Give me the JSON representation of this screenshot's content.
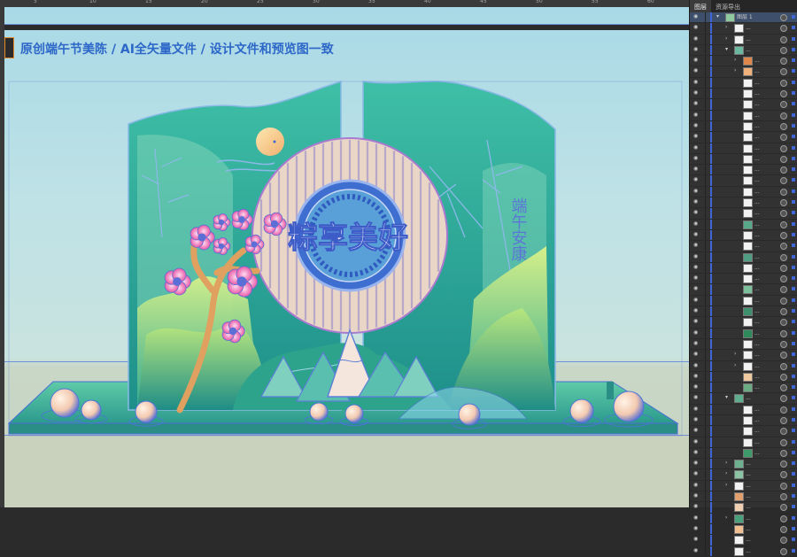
{
  "ruler": {
    "ticks": [
      "5",
      "10",
      "15",
      "20",
      "25",
      "30",
      "35",
      "40",
      "45",
      "50",
      "55",
      "60"
    ]
  },
  "headline": "原创端午节美陈 / AI全矢量文件 / 设计文件和预览图一致",
  "design": {
    "title": "粽享美好",
    "vertical_text": "端午安康"
  },
  "layers_panel": {
    "tabs": [
      "图层",
      "资源导出"
    ],
    "top_layer_name": "图层 1",
    "rows": [
      {
        "type": "layer",
        "indent": 0,
        "expand": "▾",
        "thumb": "#8fc9a0",
        "name": "图层 1",
        "sel": true
      },
      {
        "type": "item",
        "indent": 1,
        "expand": "›",
        "thumb": "#f2f2f2",
        "name": "...",
        "sel": false
      },
      {
        "type": "item",
        "indent": 1,
        "expand": "›",
        "thumb": "#f2f2f2",
        "name": "...",
        "sel": false
      },
      {
        "type": "item",
        "indent": 1,
        "expand": "▾",
        "thumb": "#6cb7a0",
        "name": "...",
        "sel": false
      },
      {
        "type": "item",
        "indent": 2,
        "expand": "›",
        "thumb": "#e0874c",
        "name": "...",
        "sel": false
      },
      {
        "type": "item",
        "indent": 2,
        "expand": "›",
        "thumb": "#f0b27a",
        "name": "...",
        "sel": false
      },
      {
        "type": "item",
        "indent": 2,
        "expand": "",
        "thumb": "#f2f2f2",
        "name": "...",
        "sel": false
      },
      {
        "type": "item",
        "indent": 2,
        "expand": "",
        "thumb": "#f2f2f2",
        "name": "...",
        "sel": false
      },
      {
        "type": "item",
        "indent": 2,
        "expand": "",
        "thumb": "#f2f2f2",
        "name": "...",
        "sel": false
      },
      {
        "type": "item",
        "indent": 2,
        "expand": "",
        "thumb": "#f2f2f2",
        "name": "...",
        "sel": false
      },
      {
        "type": "item",
        "indent": 2,
        "expand": "",
        "thumb": "#f2f2f2",
        "name": "...",
        "sel": false
      },
      {
        "type": "item",
        "indent": 2,
        "expand": "",
        "thumb": "#f2f2f2",
        "name": "...",
        "sel": false
      },
      {
        "type": "item",
        "indent": 2,
        "expand": "",
        "thumb": "#f2f2f2",
        "name": "...",
        "sel": false
      },
      {
        "type": "item",
        "indent": 2,
        "expand": "",
        "thumb": "#f2f2f2",
        "name": "...",
        "sel": false
      },
      {
        "type": "item",
        "indent": 2,
        "expand": "",
        "thumb": "#f2f2f2",
        "name": "...",
        "sel": false
      },
      {
        "type": "item",
        "indent": 2,
        "expand": "",
        "thumb": "#f2f2f2",
        "name": "...",
        "sel": false
      },
      {
        "type": "item",
        "indent": 2,
        "expand": "",
        "thumb": "#f2f2f2",
        "name": "...",
        "sel": false
      },
      {
        "type": "item",
        "indent": 2,
        "expand": "",
        "thumb": "#f2f2f2",
        "name": "...",
        "sel": false
      },
      {
        "type": "item",
        "indent": 2,
        "expand": "",
        "thumb": "#f2f2f2",
        "name": "...",
        "sel": false
      },
      {
        "type": "item",
        "indent": 2,
        "expand": "",
        "thumb": "#5aa88a",
        "name": "...",
        "sel": false
      },
      {
        "type": "item",
        "indent": 2,
        "expand": "",
        "thumb": "#f2f2f2",
        "name": "...",
        "sel": false
      },
      {
        "type": "item",
        "indent": 2,
        "expand": "",
        "thumb": "#f2f2f2",
        "name": "...",
        "sel": false
      },
      {
        "type": "item",
        "indent": 2,
        "expand": "",
        "thumb": "#4f9e84",
        "name": "...",
        "sel": false
      },
      {
        "type": "item",
        "indent": 2,
        "expand": "",
        "thumb": "#f2f2f2",
        "name": "...",
        "sel": false
      },
      {
        "type": "item",
        "indent": 2,
        "expand": "",
        "thumb": "#f2f2f2",
        "name": "...",
        "sel": false
      },
      {
        "type": "item",
        "indent": 2,
        "expand": "",
        "thumb": "#7bbf9a",
        "name": "...",
        "sel": false
      },
      {
        "type": "item",
        "indent": 2,
        "expand": "",
        "thumb": "#f2f2f2",
        "name": "...",
        "sel": false
      },
      {
        "type": "item",
        "indent": 2,
        "expand": "",
        "thumb": "#3e8f6c",
        "name": "...",
        "sel": false
      },
      {
        "type": "item",
        "indent": 2,
        "expand": "",
        "thumb": "#f2f2f2",
        "name": "...",
        "sel": false
      },
      {
        "type": "item",
        "indent": 2,
        "expand": "",
        "thumb": "#2e8a5a",
        "name": "...",
        "sel": false
      },
      {
        "type": "item",
        "indent": 2,
        "expand": "",
        "thumb": "#f2f2f2",
        "name": "...",
        "sel": false
      },
      {
        "type": "item",
        "indent": 2,
        "expand": "›",
        "thumb": "#f2f2f2",
        "name": "...",
        "sel": false
      },
      {
        "type": "item",
        "indent": 2,
        "expand": "›",
        "thumb": "#f2f2f2",
        "name": "...",
        "sel": false
      },
      {
        "type": "item",
        "indent": 2,
        "expand": "",
        "thumb": "#f0c9a0",
        "name": "...",
        "sel": false
      },
      {
        "type": "item",
        "indent": 2,
        "expand": "",
        "thumb": "#6aab84",
        "name": "...",
        "sel": false
      },
      {
        "type": "item",
        "indent": 1,
        "expand": "▾",
        "thumb": "#5fae8e",
        "name": "...",
        "sel": false
      },
      {
        "type": "item",
        "indent": 2,
        "expand": "",
        "thumb": "#f2f2f2",
        "name": "...",
        "sel": false
      },
      {
        "type": "item",
        "indent": 2,
        "expand": "",
        "thumb": "#f2f2f2",
        "name": "...",
        "sel": false
      },
      {
        "type": "item",
        "indent": 2,
        "expand": "",
        "thumb": "#f2f2f2",
        "name": "...",
        "sel": false
      },
      {
        "type": "item",
        "indent": 2,
        "expand": "",
        "thumb": "#f2f2f2",
        "name": "...",
        "sel": false
      },
      {
        "type": "item",
        "indent": 2,
        "expand": "",
        "thumb": "#3e9a6a",
        "name": "...",
        "sel": false
      },
      {
        "type": "item",
        "indent": 1,
        "expand": "›",
        "thumb": "#6cb090",
        "name": "...",
        "sel": false
      },
      {
        "type": "item",
        "indent": 1,
        "expand": "›",
        "thumb": "#8cc3a4",
        "name": "...",
        "sel": false
      },
      {
        "type": "item",
        "indent": 1,
        "expand": "›",
        "thumb": "#f2f2f2",
        "name": "...",
        "sel": false
      },
      {
        "type": "item",
        "indent": 1,
        "expand": "",
        "thumb": "#e0a070",
        "name": "...",
        "sel": false
      },
      {
        "type": "item",
        "indent": 1,
        "expand": "",
        "thumb": "#f0d0b0",
        "name": "...",
        "sel": false
      },
      {
        "type": "item",
        "indent": 1,
        "expand": "›",
        "thumb": "#4aa07a",
        "name": "...",
        "sel": false
      },
      {
        "type": "item",
        "indent": 1,
        "expand": "",
        "thumb": "#f0c090",
        "name": "...",
        "sel": false
      },
      {
        "type": "item",
        "indent": 1,
        "expand": "",
        "thumb": "#f2f2f2",
        "name": "...",
        "sel": false
      },
      {
        "type": "item",
        "indent": 1,
        "expand": "",
        "thumb": "#f2f2f2",
        "name": "...",
        "sel": false
      }
    ]
  }
}
